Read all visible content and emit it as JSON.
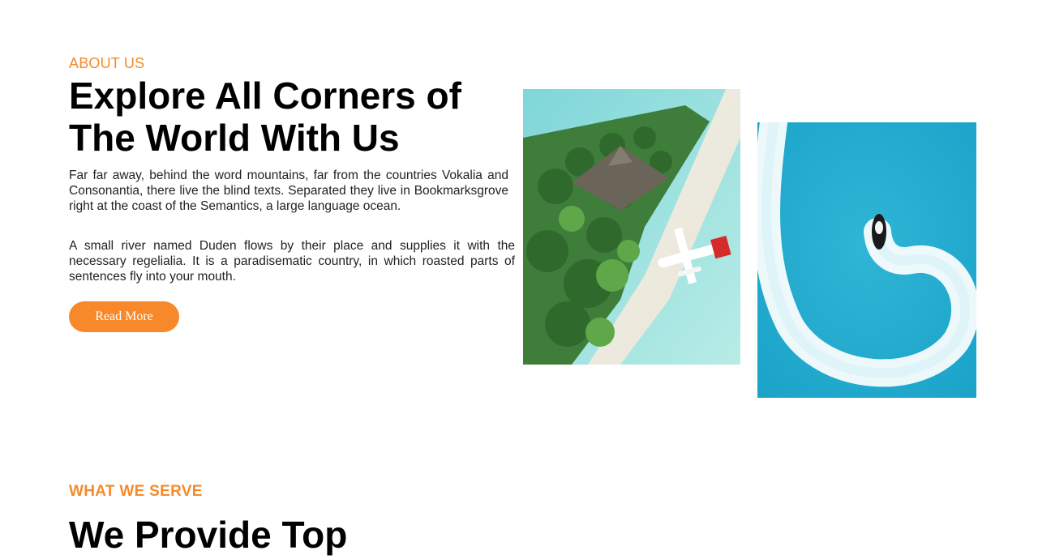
{
  "about": {
    "kicker": "ABOUT US",
    "title": "Explore All Corners of The World With Us",
    "paragraph_1": "Far far away, behind the word mountains, far from the countries Vokalia and Consonantia, there live the blind texts. Separated they live in Bookmarksgrove right at the coast of the Semantics, a large language ocean.",
    "paragraph_2": "A small river named Duden flows by their place and supplies it with the necessary regelialia. It is a paradisematic country, in which roasted parts of sentences fly into your mouth.",
    "button_label": "Read More"
  },
  "serve": {
    "kicker": "WHAT WE SERVE",
    "title": "We Provide Top"
  },
  "colors": {
    "accent": "#f58a2b",
    "button": "#f7892a",
    "text": "#000000"
  },
  "images": {
    "photo_1": "island-beach-seaplane-photo",
    "photo_2": "jet-ski-ocean-photo"
  }
}
